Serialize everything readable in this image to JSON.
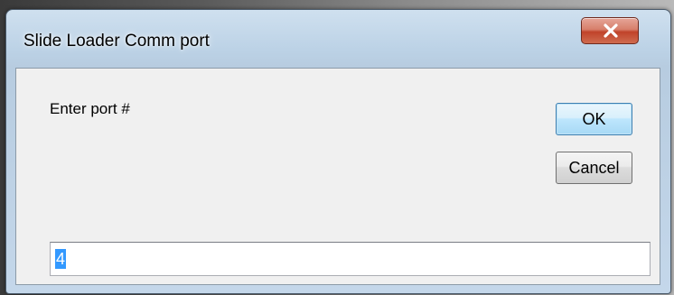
{
  "window": {
    "title": "Slide Loader Comm port",
    "close_icon": "close-icon"
  },
  "dialog": {
    "prompt": "Enter port #",
    "ok_label": "OK",
    "cancel_label": "Cancel"
  },
  "input": {
    "value": "4",
    "selected": true
  },
  "colors": {
    "selection": "#3399ff",
    "close_button": "#c0432a",
    "client_background": "#f0f0f0"
  }
}
